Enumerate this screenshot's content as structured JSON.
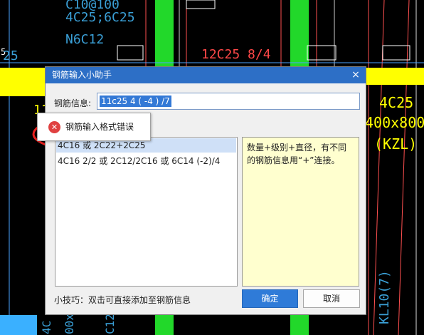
{
  "cad": {
    "top_text_1": "C10@100",
    "top_text_2": "4C25;6C25",
    "top_text_3": "N6C12",
    "beam_text": "12C25 8/4",
    "left_num": "5",
    "left_num2": "25",
    "left_num3": "11",
    "right_text_1": "4C25",
    "right_text_2": "400x800",
    "right_text_3": "(KZL)",
    "bottom_right": "KL10(7)",
    "bottom_left_1": "4C",
    "bottom_left_2": "00x",
    "bottom_left_3": "C12@"
  },
  "dialog": {
    "title": "钢筋输入小助手",
    "close_glyph": "×",
    "field_label": "钢筋信息:",
    "field_value": "11c25 4 ( -4 ) /7",
    "list_items": [
      "4C16 或 2C22+2C25",
      "4C16 2/2 或 2C12/2C16 或 6C14 (-2)/4"
    ],
    "hint_text": "数量+级别+直径，有不同的钢筋信息用“+”连接。",
    "tip_text": "小技巧：双击可直接添加至钢筋信息",
    "ok_label": "确定",
    "cancel_label": "取消"
  },
  "error_tooltip": {
    "icon": "error-icon",
    "glyph": "✕",
    "message": "钢筋输入格式错误"
  },
  "colors": {
    "title_bar": "#2d6fc6",
    "selection": "#3379d6",
    "ok_button": "#2f7bd8",
    "annotation_circle": "#e8201e",
    "cad_green": "#22d82a",
    "cad_yellow": "#ffff00"
  }
}
